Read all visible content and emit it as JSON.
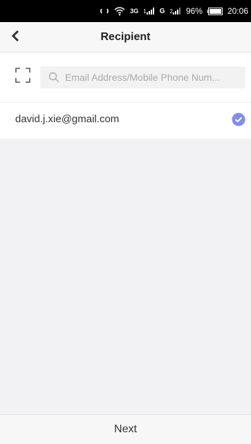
{
  "status_bar": {
    "battery": "96%",
    "time": "20:06",
    "network_label": "3G",
    "signal_labels": [
      "1",
      "G",
      "2"
    ]
  },
  "header": {
    "title": "Recipient"
  },
  "search": {
    "placeholder": "Email Address/Mobile Phone Num...",
    "value": ""
  },
  "recipients": [
    {
      "email": "david.j.xie@gmail.com",
      "selected": true
    }
  ],
  "footer": {
    "next_label": "Next"
  },
  "colors": {
    "check_accent": "#7d8ef0",
    "status_bar_bg": "#000000",
    "page_bg": "#f2f2f4"
  }
}
